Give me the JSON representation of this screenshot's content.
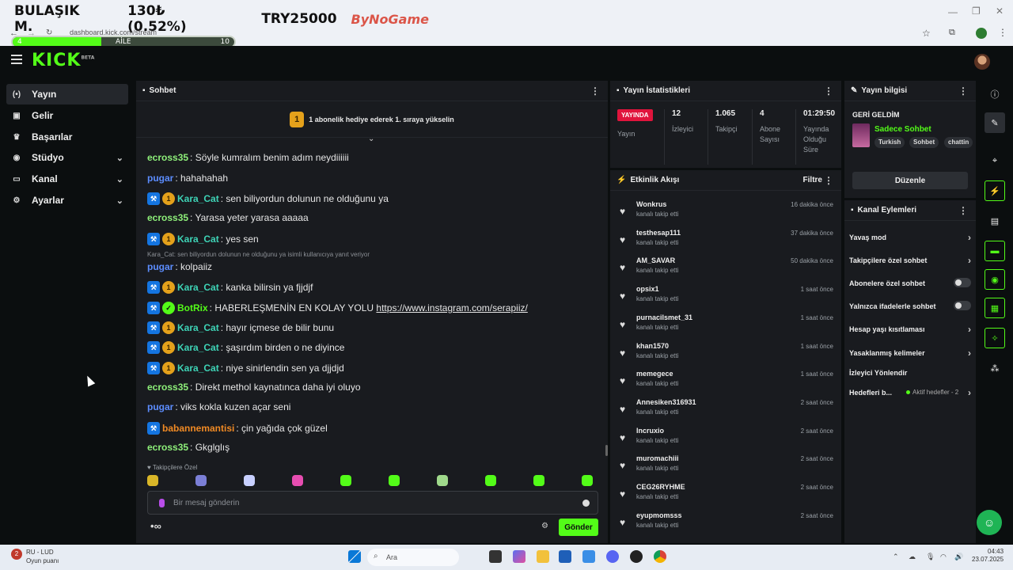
{
  "overlay": {
    "ticker_name": "BULAŞIK M.",
    "ticker_change": "130₺ (0.52%)",
    "ticker_amount": "TRY25000",
    "brand": "ByNoGame",
    "progress_label": "AİLE",
    "progress_left": "4",
    "progress_right": "10",
    "progress_fraction": 0.4
  },
  "browser": {
    "url": "dashboard.kick.com/stream"
  },
  "app": {
    "logo": "KICK",
    "logo_badge": "BETA"
  },
  "sidebar": {
    "items": [
      {
        "label": "Yayın",
        "icon": "broadcast-icon"
      },
      {
        "label": "Gelir",
        "icon": "wallet-icon"
      },
      {
        "label": "Başarılar",
        "icon": "trophy-icon"
      },
      {
        "label": "Stüdyo",
        "icon": "studio-icon"
      },
      {
        "label": "Kanal",
        "icon": "channel-icon"
      },
      {
        "label": "Ayarlar",
        "icon": "gear-icon"
      }
    ]
  },
  "chat": {
    "title": "Sohbet",
    "pinned_badge": "1",
    "pinned": "1 abonelik hediye ederek 1. sıraya yükselin",
    "messages": [
      {
        "user": "ecross35",
        "text": ": Söyle kumralım benim adım neydiiiiii",
        "color": "#8ef07a"
      },
      {
        "user": "pugar",
        "text": ": hahahahah",
        "color": "#5c8dff"
      },
      {
        "user": "Kara_Cat",
        "text": ": sen biliyordun dolunun ne olduğunu ya",
        "color": "#3ed4b7"
      },
      {
        "user": "ecross35",
        "text": ": Yarasa yeter yarasa aaaaa",
        "color": "#8ef07a"
      },
      {
        "user": "Kara_Cat",
        "text": ": yes sen",
        "color": "#3ed4b7"
      },
      {
        "user": "pugar",
        "text": ": kolpaiiz",
        "color": "#5c8dff"
      },
      {
        "user": "Kara_Cat",
        "text": ": kanka bilirsin ya fjjdjf",
        "color": "#3ed4b7"
      },
      {
        "user": "BotRix",
        "text": ": HABERLEŞMENİN EN KOLAY YOLU ",
        "link": "https://www.instagram.com/serapiiz/",
        "color": "#53fc18"
      },
      {
        "user": "Kara_Cat",
        "text": ": hayır içmese de bilir bunu",
        "color": "#3ed4b7"
      },
      {
        "user": "Kara_Cat",
        "text": ": şaşırdım birden o ne diyince",
        "color": "#3ed4b7"
      },
      {
        "user": "Kara_Cat",
        "text": ": niye sinirlendin sen ya djjdjd",
        "color": "#3ed4b7"
      },
      {
        "user": "ecross35",
        "text": ": Direkt methol kaynatınca daha iyi oluyo",
        "color": "#8ef07a"
      },
      {
        "user": "pugar",
        "text": ": viks kokla kuzen açar seni",
        "color": "#5c8dff"
      },
      {
        "user": "babannemantisi",
        "text": ": çin yağıda çok güzel",
        "color": "#f08a24"
      },
      {
        "user": "ecross35",
        "text": ": Gkglglış",
        "color": "#8ef07a"
      }
    ],
    "reply_note": "Kara_Cat: sen biliyordun dolunun ne olduğunu ya isimli kullanıcıya yanıt veriyor",
    "followers_only": "Takipçilere Özel",
    "input_placeholder": "Bir mesaj gönderin",
    "send_label": "Gönder",
    "infinity": "∞"
  },
  "stats": {
    "title": "Yayın İstatistikleri",
    "live_label": "YAYINDA",
    "stream_label": "Yayın",
    "items": [
      {
        "value": "12",
        "label": "İzleyici"
      },
      {
        "value": "1.065",
        "label": "Takipçi"
      },
      {
        "value": "4",
        "label": "Abone Sayısı"
      },
      {
        "value": "01:29:50",
        "label": "Yayında Olduğu Süre"
      }
    ]
  },
  "feed": {
    "title": "Etkinlik Akışı",
    "filter_label": "Filtre",
    "items": [
      {
        "name": "Wonkrus",
        "action": "kanalı takip etti",
        "time": "16 dakika önce"
      },
      {
        "name": "testhesap111",
        "action": "kanalı takip etti",
        "time": "37 dakika önce"
      },
      {
        "name": "AM_SAVAR",
        "action": "kanalı takip etti",
        "time": "50 dakika önce"
      },
      {
        "name": "opsix1",
        "action": "kanalı takip etti",
        "time": "1 saat önce"
      },
      {
        "name": "purnacilsmet_31",
        "action": "kanalı takip etti",
        "time": "1 saat önce"
      },
      {
        "name": "khan1570",
        "action": "kanalı takip etti",
        "time": "1 saat önce"
      },
      {
        "name": "memegece",
        "action": "kanalı takip etti",
        "time": "1 saat önce"
      },
      {
        "name": "Annesiken316931",
        "action": "kanalı takip etti",
        "time": "2 saat önce"
      },
      {
        "name": "Incruxio",
        "action": "kanalı takip etti",
        "time": "2 saat önce"
      },
      {
        "name": "muromachiii",
        "action": "kanalı takip etti",
        "time": "2 saat önce"
      },
      {
        "name": "CEG26RYHME",
        "action": "kanalı takip etti",
        "time": "2 saat önce"
      },
      {
        "name": "eyupmomsss",
        "action": "kanalı takip etti",
        "time": "2 saat önce"
      }
    ]
  },
  "stream_info": {
    "title": "Yayın bilgisi",
    "stream_title": "GERİ GELDİM",
    "category": "Sadece Sohbet",
    "tags": [
      "Turkish",
      "Sohbet",
      "chattin"
    ],
    "edit_label": "Düzenle"
  },
  "channel_actions": {
    "title": "Kanal Eylemleri",
    "items": [
      {
        "label": "Yavaş mod",
        "kind": "chevron"
      },
      {
        "label": "Takipçilere özel sohbet",
        "kind": "chevron"
      },
      {
        "label": "Abonelere özel sohbet",
        "kind": "toggle",
        "on": false
      },
      {
        "label": "Yalnızca ifadelerle sohbet",
        "kind": "toggle",
        "on": false
      },
      {
        "label": "Hesap yaşı kısıtlaması",
        "kind": "chevron"
      },
      {
        "label": "Yasaklanmış kelimeler",
        "kind": "chevron"
      },
      {
        "label": "İzleyici Yönlendir",
        "kind": "none"
      },
      {
        "label": "Hedefleri b...",
        "kind": "chevron",
        "sub": "Aktif hedefler - 2"
      }
    ]
  },
  "taskbar": {
    "weather_title": "RU - LUD",
    "weather_sub": "Oyun puanı",
    "notif_count": "2",
    "search_placeholder": "Ara",
    "time": "04:43",
    "date": "23.07.2025"
  },
  "colors": {
    "accent": "#53fc18",
    "live": "#e0143c",
    "panel": "#191b1f",
    "background": "#0b0e0f"
  }
}
